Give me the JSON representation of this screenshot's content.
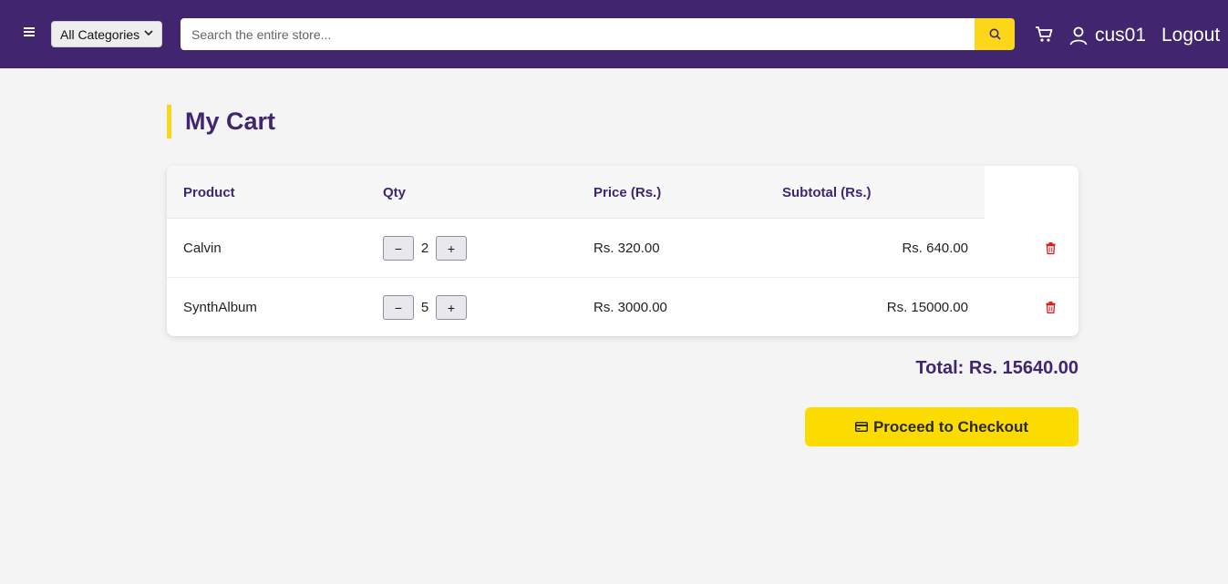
{
  "header": {
    "category_select": {
      "selected": "All Categories"
    },
    "search": {
      "placeholder": "Search the entire store..."
    },
    "user": {
      "name": "cus01"
    },
    "logout_label": "Logout"
  },
  "page_title": "My Cart",
  "cart": {
    "columns": [
      "Product",
      "Qty",
      "Price (Rs.)",
      "Subtotal (Rs.)"
    ],
    "items": [
      {
        "product": "Calvin",
        "qty": "2",
        "price": "Rs. 320.00",
        "subtotal": "Rs. 640.00"
      },
      {
        "product": "SynthAlbum",
        "qty": "5",
        "price": "Rs. 3000.00",
        "subtotal": "Rs. 15000.00"
      }
    ],
    "qty_decrement_label": "−",
    "qty_increment_label": "+",
    "total_label": "Total: Rs. 15640.00"
  },
  "checkout": {
    "label": "Proceed to Checkout"
  },
  "colors": {
    "brand": "#41266f",
    "accent": "#fcd619",
    "danger": "#e0191f"
  },
  "icons": {
    "menu": "hamburger-icon",
    "search": "search-icon",
    "cart": "cart-icon",
    "user": "user-icon",
    "delete": "trash-icon",
    "checkout": "credit-card-icon"
  }
}
